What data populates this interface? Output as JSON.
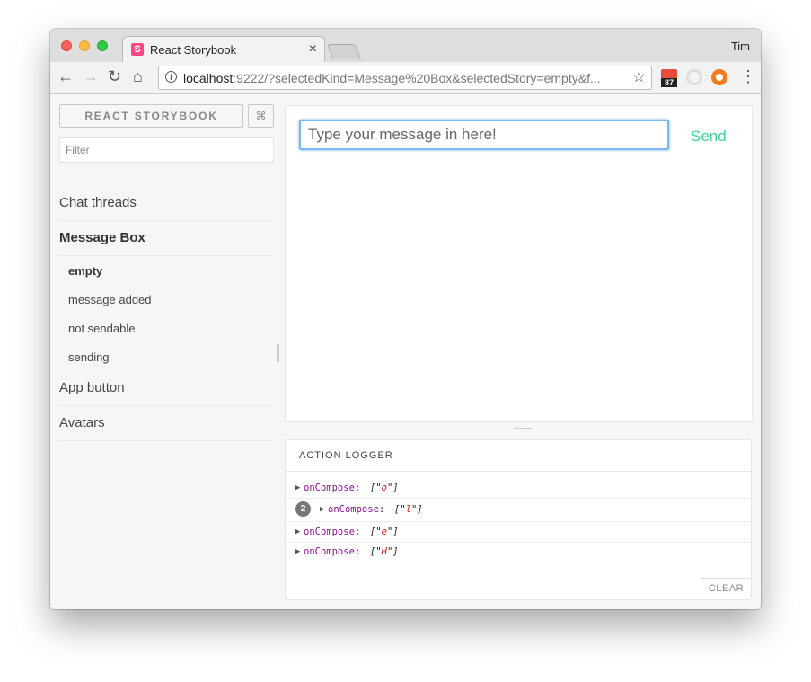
{
  "browser": {
    "tab_title": "React Storybook",
    "tab_favicon": "S",
    "tab_close": "×",
    "profile_name": "Tim",
    "url_host": "localhost",
    "url_rest": ":9222/?selectedKind=Message%20Box&selectedStory=empty&f...",
    "extension_badge": "87",
    "icons": [
      "back-arrow-icon",
      "forward-arrow-icon",
      "reload-icon",
      "home-icon",
      "info-icon",
      "star-icon",
      "calendar-extension-icon",
      "ring-extension-icon",
      "lifebuoy-extension-icon",
      "kebab-menu-icon"
    ]
  },
  "sidebar": {
    "brand": "REACT STORYBOOK",
    "shortcut": "⌘",
    "filter_placeholder": "Filter",
    "kinds": [
      {
        "label": "Chat threads"
      },
      {
        "label": "Message Box",
        "active": true
      },
      {
        "label": "App button"
      },
      {
        "label": "Avatars"
      }
    ],
    "stories": [
      {
        "label": "empty",
        "active": true
      },
      {
        "label": "message added"
      },
      {
        "label": "not sendable"
      },
      {
        "label": "sending"
      }
    ]
  },
  "preview": {
    "input_placeholder": "Type your message in here!",
    "send_label": "Send",
    "send_color": "#3fd39b"
  },
  "action_logger": {
    "title": "ACTION LOGGER",
    "clear_label": "CLEAR",
    "entries": [
      {
        "name": "onCompose",
        "value": "o",
        "count": null
      },
      {
        "name": "onCompose",
        "value": "l",
        "count": "2"
      },
      {
        "name": "onCompose",
        "value": "e",
        "count": null
      },
      {
        "name": "onCompose",
        "value": "H",
        "count": null
      }
    ]
  },
  "colors": {
    "accent_pink": "#ff4785",
    "input_focus": "#7cb6f5",
    "log_key": "#881391",
    "log_string": "#c41a16"
  }
}
